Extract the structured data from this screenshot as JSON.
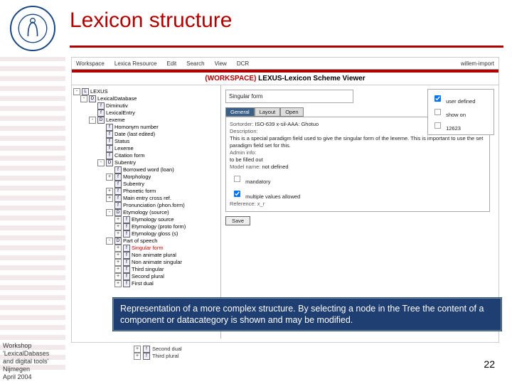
{
  "slide": {
    "title": "Lexicon structure",
    "page_number": "22"
  },
  "footer": {
    "line1": "Workshop",
    "line2": "'LexicalDabases",
    "line3": "and digital tools'",
    "line4": "Nijmegen",
    "line5": "April 2004"
  },
  "app": {
    "menu": [
      "Workspace",
      "Lexica Resource",
      "Edit",
      "Search",
      "View",
      "DCR"
    ],
    "username": "willem-import",
    "title_ws": "(WORKSPACE)",
    "title_rest": " LEXUS-Lexicon Scheme Viewer",
    "tree": [
      {
        "lvl": 0,
        "exp": "-",
        "label": "LEXUS",
        "icon": "L"
      },
      {
        "lvl": 1,
        "exp": "-",
        "label": "LexicalDatabase",
        "icon": "D"
      },
      {
        "lvl": 2,
        "exp": "",
        "label": "Diminutiv",
        "icon": "f"
      },
      {
        "lvl": 2,
        "exp": "",
        "label": "LexicalEntry",
        "icon": "f"
      },
      {
        "lvl": 2,
        "exp": "-",
        "label": "Lexeme",
        "icon": "D"
      },
      {
        "lvl": 3,
        "exp": "",
        "label": "Homonym number",
        "icon": "f"
      },
      {
        "lvl": 3,
        "exp": "",
        "label": "Date (last edited)",
        "icon": "f"
      },
      {
        "lvl": 3,
        "exp": "",
        "label": "Status",
        "icon": "f"
      },
      {
        "lvl": 3,
        "exp": "",
        "label": "Lexeme",
        "icon": "f"
      },
      {
        "lvl": 3,
        "exp": "",
        "label": "Citation form",
        "icon": "f"
      },
      {
        "lvl": 3,
        "exp": "-",
        "label": "Subentry",
        "icon": "D"
      },
      {
        "lvl": 4,
        "exp": "",
        "label": "Borrowed word (loan)",
        "icon": "f"
      },
      {
        "lvl": 4,
        "exp": "+",
        "label": "Morphology",
        "icon": "f"
      },
      {
        "lvl": 4,
        "exp": "",
        "label": "Subentry",
        "icon": "f"
      },
      {
        "lvl": 4,
        "exp": "+",
        "label": "Phonetic form",
        "icon": "f"
      },
      {
        "lvl": 4,
        "exp": "+",
        "label": "Main entry cross ref.",
        "icon": "f"
      },
      {
        "lvl": 4,
        "exp": "",
        "label": "Pronunciation (phon.form)",
        "icon": "f"
      },
      {
        "lvl": 4,
        "exp": "-",
        "label": "Etymology (source)",
        "icon": "D"
      },
      {
        "lvl": 5,
        "exp": "+",
        "label": "Etymology source",
        "icon": "f"
      },
      {
        "lvl": 5,
        "exp": "+",
        "label": "Etymology (proto form)",
        "icon": "f"
      },
      {
        "lvl": 5,
        "exp": "+",
        "label": "Etymology gloss (s)",
        "icon": "f"
      },
      {
        "lvl": 4,
        "exp": "-",
        "label": "Part of speech",
        "icon": "D"
      },
      {
        "lvl": 5,
        "exp": "+",
        "label": "Singular form",
        "icon": "f",
        "sel": true
      },
      {
        "lvl": 5,
        "exp": "+",
        "label": "Non animate plural",
        "icon": "f"
      },
      {
        "lvl": 5,
        "exp": "+",
        "label": "Non animate singular",
        "icon": "f"
      },
      {
        "lvl": 5,
        "exp": "+",
        "label": "Third singular",
        "icon": "f"
      },
      {
        "lvl": 5,
        "exp": "+",
        "label": "Second plural",
        "icon": "f"
      },
      {
        "lvl": 5,
        "exp": "+",
        "label": "First dual",
        "icon": "f"
      }
    ],
    "detail": {
      "field_name": "Singular form",
      "options": {
        "user_defined": "user defined",
        "show_on": "show on",
        "id": "12623"
      },
      "tabs": [
        "General",
        "Layout",
        "Open"
      ],
      "panel": {
        "sortorder_lbl": "Sortorder:",
        "sortorder_val": "ISO-639 x-sil-AAA: Ghotuo",
        "desc_lbl": "Description:",
        "desc_val": "This is a special paradigm field used to give the singular form of the lexeme. This is important to use the set paradigm field set for this.",
        "admin_lbl": "Admin info:",
        "admin_val": "to be filled out",
        "model_lbl": "Model name:",
        "model_val": "not defined",
        "mandatory": "mandatory",
        "multiple": "multiple values allowed",
        "ref_lbl": "Reference: x_r",
        "save": "Save"
      }
    }
  },
  "caption": "Representation of a more complex structure. By selecting a node in the Tree the content of a component or datacategory is shown and may be modified.",
  "belowcap": [
    {
      "label": "Second dual"
    },
    {
      "label": "Third plural"
    }
  ]
}
